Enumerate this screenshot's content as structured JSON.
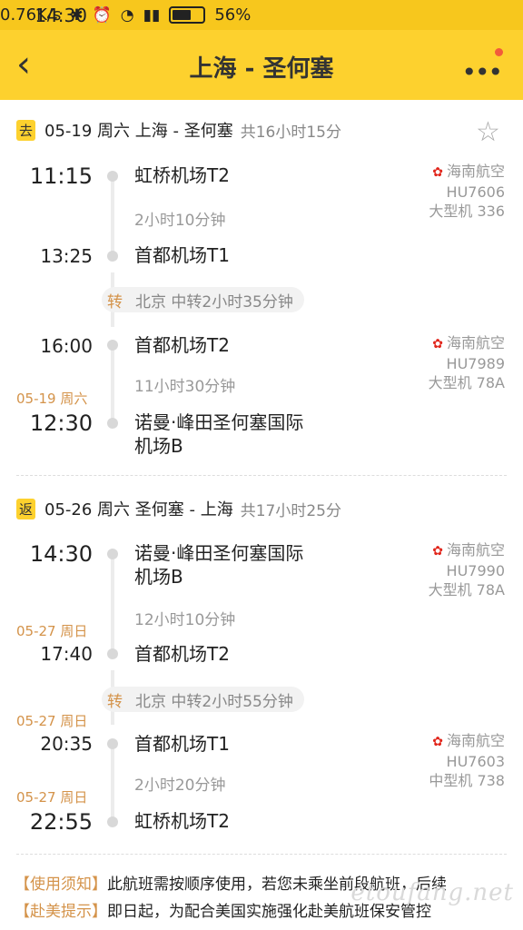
{
  "status_bar": {
    "time": "14:30",
    "speed": "0.76K/s",
    "battery": "56%"
  },
  "header": {
    "title": "上海 - 圣何塞",
    "back_icon": "chevron-left-icon",
    "more_icon": "more-dots-icon"
  },
  "outbound": {
    "tag": "去",
    "summary": "05-19 周六 上海 - 圣何塞",
    "duration": "共16小时15分",
    "stops": [
      {
        "time": "11:15",
        "airport": "虹桥机场T2"
      },
      {
        "time": "13:25",
        "airport": "首都机场T1"
      },
      {
        "time": "16:00",
        "airport": "首都机场T2"
      },
      {
        "date": "05-19 周六",
        "time": "12:30",
        "airport_line1": "诺曼·峰田圣何塞国际",
        "airport_line2": "机场B"
      }
    ],
    "legs": [
      {
        "duration": "2小时10分钟",
        "airline": "海南航空",
        "flight": "HU7606",
        "aircraft": "大型机 336"
      },
      {
        "duration": "11小时30分钟",
        "airline": "海南航空",
        "flight": "HU7989",
        "aircraft": "大型机 78A"
      }
    ],
    "transfer": {
      "label": "转",
      "text": "北京 中转2小时35分钟"
    }
  },
  "return": {
    "tag": "返",
    "summary": "05-26 周六 圣何塞 - 上海",
    "duration": "共17小时25分",
    "stops": [
      {
        "time": "14:30",
        "airport_line1": "诺曼·峰田圣何塞国际",
        "airport_line2": "机场B"
      },
      {
        "date": "05-27 周日",
        "time": "17:40",
        "airport": "首都机场T2"
      },
      {
        "date": "05-27 周日",
        "time": "20:35",
        "airport": "首都机场T1"
      },
      {
        "date": "05-27 周日",
        "time": "22:55",
        "airport": "虹桥机场T2"
      }
    ],
    "legs": [
      {
        "duration": "12小时10分钟",
        "airline": "海南航空",
        "flight": "HU7990",
        "aircraft": "大型机 78A"
      },
      {
        "duration": "2小时20分钟",
        "airline": "海南航空",
        "flight": "HU7603",
        "aircraft": "中型机 738"
      }
    ],
    "transfer": {
      "label": "转",
      "text": "北京 中转2小时55分钟"
    }
  },
  "notices": [
    {
      "label": "【使用须知】",
      "text": "此航班需按顺序使用，若您未乘坐前段航班，后续"
    },
    {
      "label": "【赴美提示】",
      "text": "即日起，为配合美国实施强化赴美航班保安管控"
    }
  ],
  "watermark": "etoufang.net",
  "colors": {
    "accent": "#fdd12e",
    "date": "#d4934a",
    "airline_logo": "#e1251b"
  }
}
